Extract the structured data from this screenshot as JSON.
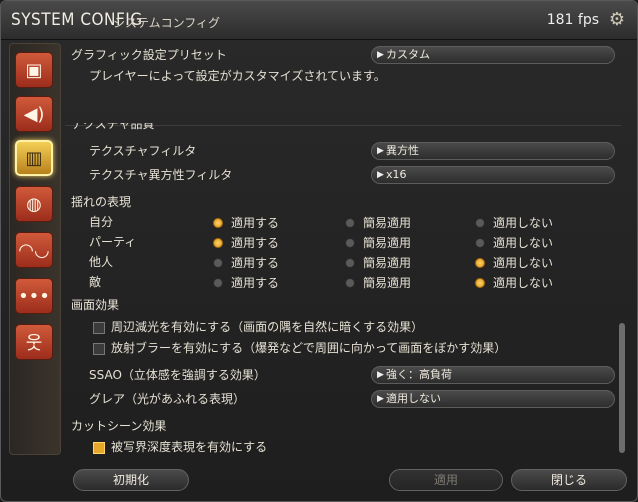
{
  "titlebar": {
    "title": "SYSTEM CONFIG",
    "subtitle": "システムコンフィグ",
    "fps": "181 fps"
  },
  "sidebar": {
    "items": [
      {
        "name": "display",
        "icon": "monitor-icon",
        "glyph": "⇪"
      },
      {
        "name": "sound",
        "icon": "speaker-icon",
        "glyph": "🔊"
      },
      {
        "name": "graphics",
        "icon": "graphics-quality-icon",
        "glyph": "▥"
      },
      {
        "name": "mouse",
        "icon": "mouse-icon",
        "glyph": "🖱"
      },
      {
        "name": "gamepad",
        "icon": "gamepad-icon",
        "glyph": "🎮"
      },
      {
        "name": "other",
        "icon": "more-icon",
        "glyph": "•••"
      },
      {
        "name": "accessibility",
        "icon": "person-icon",
        "glyph": "☥"
      }
    ]
  },
  "preset": {
    "label": "グラフィック設定プリセット",
    "value": "カスタム",
    "description": "プレイヤーによって設定がカスタマイズされています。"
  },
  "texture": {
    "section_partial": "テクスチャ品質",
    "filter_label": "テクスチャフィルタ",
    "filter_value": "異方性",
    "aniso_label": "テクスチャ異方性フィルタ",
    "aniso_value": "x16"
  },
  "sway": {
    "section": "揺れの表現",
    "options": [
      "適用する",
      "簡易適用",
      "適用しない"
    ],
    "rows": [
      {
        "label": "自分",
        "selected": 0
      },
      {
        "label": "パーティ",
        "selected": 0
      },
      {
        "label": "他人",
        "selected": 2
      },
      {
        "label": "敵",
        "selected": 2
      }
    ]
  },
  "effects": {
    "section": "画面効果",
    "vignette": {
      "label": "周辺減光を有効にする（画面の隅を自然に暗くする効果）",
      "checked": false
    },
    "radial_blur": {
      "label": "放射ブラーを有効にする（爆発などで周囲に向かって画面をぼかす効果）",
      "checked": false
    },
    "ssao_label": "SSAO（立体感を強調する効果）",
    "ssao_value": "強く：高負荷",
    "glare_label": "グレア（光があふれる表現）",
    "glare_value": "適用しない"
  },
  "cutscene": {
    "section": "カットシーン効果",
    "dof": {
      "label": "被写界深度表現を有効にする",
      "checked": true
    }
  },
  "footer": {
    "reset": "初期化",
    "apply": "適用",
    "close": "閉じる"
  }
}
